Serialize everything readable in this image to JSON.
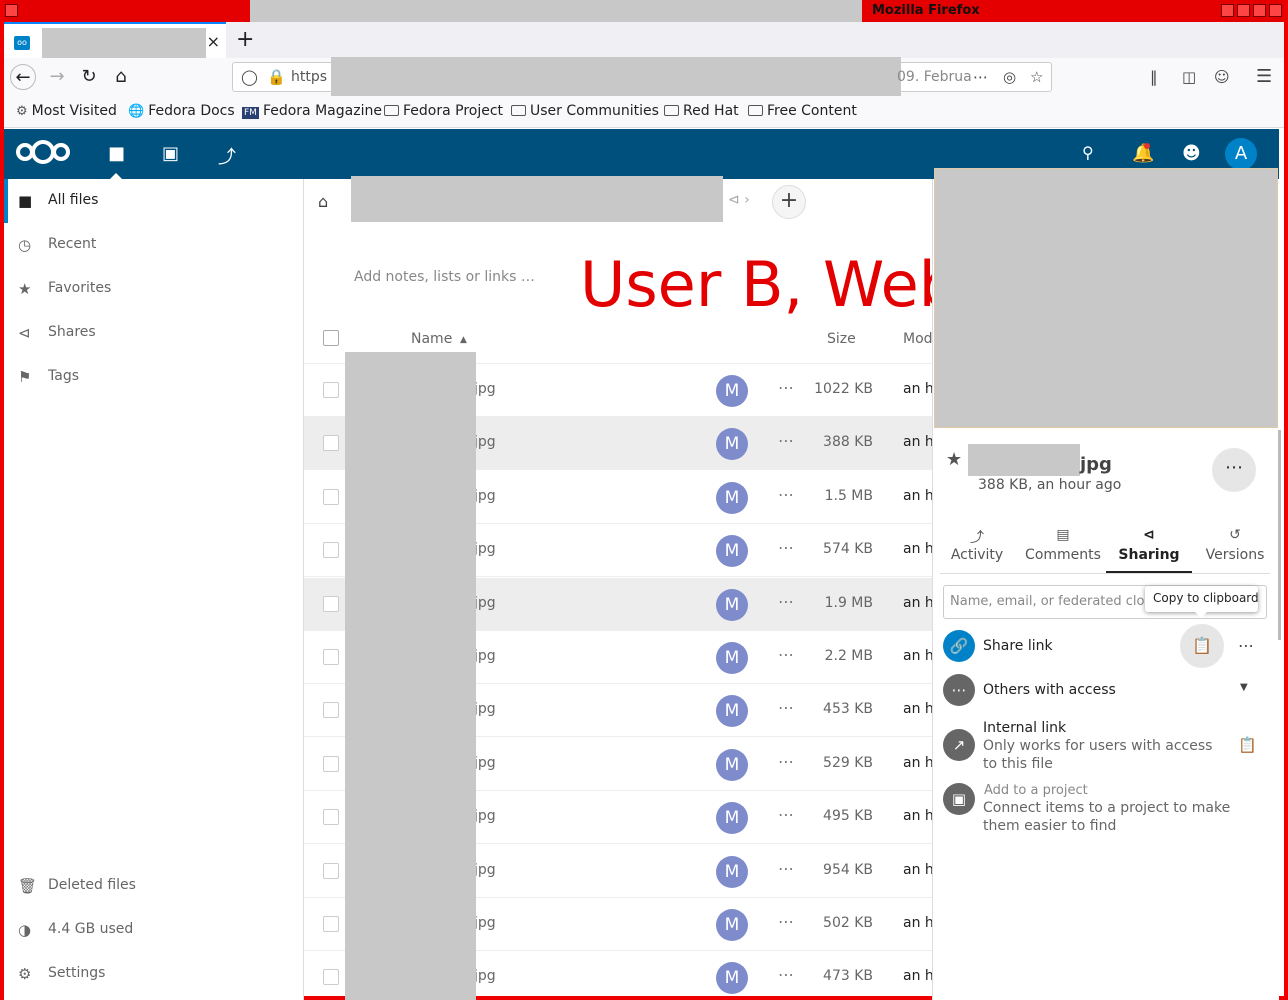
{
  "window": {
    "title": "Mozilla Firefox"
  },
  "browser": {
    "tab_close": "×",
    "newtab": "+",
    "url_prefix": "https",
    "url_date": "09. Februa",
    "bookmarks": [
      "Most Visited",
      "Fedora Docs",
      "Fedora Magazine",
      "Fedora Project",
      "User Communities",
      "Red Hat",
      "Free Content"
    ]
  },
  "header": {
    "avatar_letter": "A"
  },
  "sidebar": {
    "items": [
      {
        "label": "All files",
        "icon": "folder-icon"
      },
      {
        "label": "Recent",
        "icon": "clock-icon"
      },
      {
        "label": "Favorites",
        "icon": "star-icon"
      },
      {
        "label": "Shares",
        "icon": "share-icon"
      },
      {
        "label": "Tags",
        "icon": "tag-icon"
      }
    ],
    "deleted": "Deleted files",
    "quota": "4.4 GB used",
    "settings": "Settings"
  },
  "main": {
    "notes_placeholder": "Add notes, lists or links …",
    "overlay_text": "User B, Web",
    "columns": {
      "name": "Name",
      "size": "Size",
      "modified": "Mod"
    },
    "rows": [
      {
        "name": "jpg",
        "avatar": "M",
        "size": "1022 KB",
        "modified": "an ho"
      },
      {
        "name": "jpg",
        "avatar": "M",
        "size": "388 KB",
        "modified": "an ho"
      },
      {
        "name": "jpg",
        "avatar": "M",
        "size": "1.5 MB",
        "modified": "an ho"
      },
      {
        "name": "jpg",
        "avatar": "M",
        "size": "574 KB",
        "modified": "an ho"
      },
      {
        "name": "jpg",
        "avatar": "M",
        "size": "1.9 MB",
        "modified": "an ho"
      },
      {
        "name": "jpg",
        "avatar": "M",
        "size": "2.2 MB",
        "modified": "an ho"
      },
      {
        "name": "jpg",
        "avatar": "M",
        "size": "453 KB",
        "modified": "an ho"
      },
      {
        "name": "jpg",
        "avatar": "M",
        "size": "529 KB",
        "modified": "an ho"
      },
      {
        "name": "jpg",
        "avatar": "M",
        "size": "495 KB",
        "modified": "an ho"
      },
      {
        "name": "jpg",
        "avatar": "M",
        "size": "954 KB",
        "modified": "an ho"
      },
      {
        "name": "jpg",
        "avatar": "M",
        "size": "502 KB",
        "modified": "an ho"
      },
      {
        "name": "jpg",
        "avatar": "M",
        "size": "473 KB",
        "modified": "an ho"
      }
    ]
  },
  "details": {
    "filename": "jpg",
    "info": "388 KB, an hour ago",
    "tabs": [
      "Activity",
      "Comments",
      "Sharing",
      "Versions"
    ],
    "share_placeholder": "Name, email, or federated cloud ID",
    "tooltip": "Copy to clipboard",
    "share_link": "Share link",
    "others_access": "Others with access",
    "internal_link": "Internal link",
    "internal_link_sub": "Only works for users with access to this file",
    "add_project": "Add to a project",
    "add_project_sub": "Connect items to a project to make them easier to find"
  }
}
